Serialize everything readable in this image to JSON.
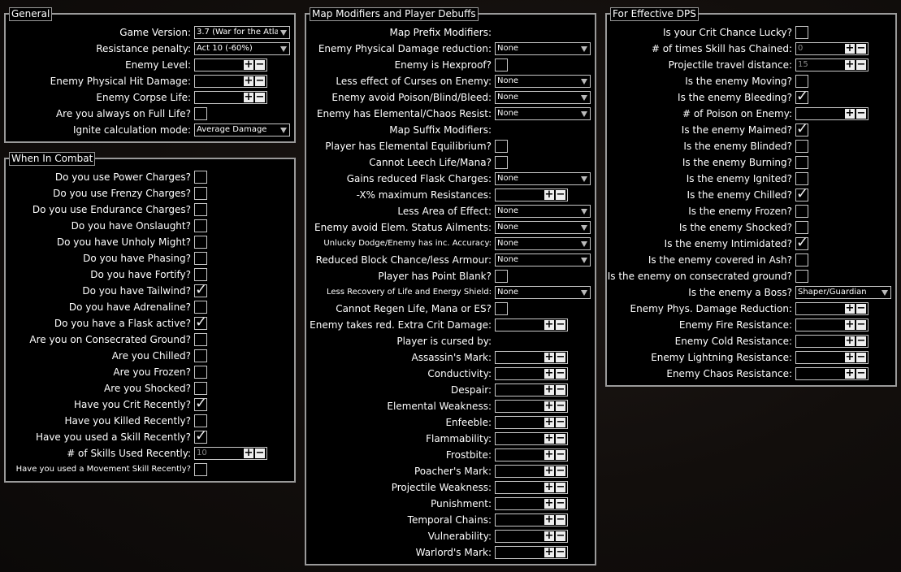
{
  "general": {
    "title": "General",
    "rows": [
      {
        "label": "Game Version:",
        "type": "dropdown",
        "value": "3.7 (War for the Atlas"
      },
      {
        "label": "Resistance penalty:",
        "type": "dropdown",
        "value": "Act 10 (-60%)"
      },
      {
        "label": "Enemy Level:",
        "type": "number",
        "value": ""
      },
      {
        "label": "Enemy Physical Hit Damage:",
        "type": "number",
        "value": ""
      },
      {
        "label": "Enemy Corpse Life:",
        "type": "number",
        "value": ""
      },
      {
        "label": "Are you always on Full Life?",
        "type": "checkbox",
        "checked": false
      },
      {
        "label": "Ignite calculation mode:",
        "type": "dropdown",
        "value": "Average Damage"
      }
    ]
  },
  "combat": {
    "title": "When In Combat",
    "rows": [
      {
        "label": "Do you use Power Charges?",
        "type": "checkbox",
        "checked": false
      },
      {
        "label": "Do you use Frenzy Charges?",
        "type": "checkbox",
        "checked": false
      },
      {
        "label": "Do you use Endurance Charges?",
        "type": "checkbox",
        "checked": false
      },
      {
        "label": "Do you have Onslaught?",
        "type": "checkbox",
        "checked": false
      },
      {
        "label": "Do you have Unholy Might?",
        "type": "checkbox",
        "checked": false
      },
      {
        "label": "Do you have Phasing?",
        "type": "checkbox",
        "checked": false
      },
      {
        "label": "Do you have Fortify?",
        "type": "checkbox",
        "checked": false
      },
      {
        "label": "Do you have Tailwind?",
        "type": "checkbox",
        "checked": true
      },
      {
        "label": "Do you have Adrenaline?",
        "type": "checkbox",
        "checked": false
      },
      {
        "label": "Do you have a Flask active?",
        "type": "checkbox",
        "checked": true
      },
      {
        "label": "Are you on Consecrated Ground?",
        "type": "checkbox",
        "checked": false
      },
      {
        "label": "Are you Chilled?",
        "type": "checkbox",
        "checked": false
      },
      {
        "label": "Are you Frozen?",
        "type": "checkbox",
        "checked": false
      },
      {
        "label": "Are you Shocked?",
        "type": "checkbox",
        "checked": false
      },
      {
        "label": "Have you Crit Recently?",
        "type": "checkbox",
        "checked": true
      },
      {
        "label": "Have you Killed Recently?",
        "type": "checkbox",
        "checked": false
      },
      {
        "label": "Have you used a Skill Recently?",
        "type": "checkbox",
        "checked": true
      },
      {
        "label": "# of Skills Used Recently:",
        "type": "number",
        "value": "10"
      },
      {
        "label": "Have you used a Movement Skill Recently?",
        "type": "checkbox",
        "checked": false,
        "small": true
      }
    ]
  },
  "map": {
    "title": "Map Modifiers and Player Debuffs",
    "rows": [
      {
        "label": "Map Prefix Modifiers:",
        "type": "none"
      },
      {
        "label": "Enemy Physical Damage reduction:",
        "type": "dropdown",
        "value": "None"
      },
      {
        "label": "Enemy is Hexproof?",
        "type": "checkbox",
        "checked": false
      },
      {
        "label": "Less effect of Curses on Enemy:",
        "type": "dropdown",
        "value": "None"
      },
      {
        "label": "Enemy avoid Poison/Blind/Bleed:",
        "type": "dropdown",
        "value": "None"
      },
      {
        "label": "Enemy has Elemental/Chaos Resist:",
        "type": "dropdown",
        "value": "None"
      },
      {
        "label": "Map Suffix Modifiers:",
        "type": "none"
      },
      {
        "label": "Player has Elemental Equilibrium?",
        "type": "checkbox",
        "checked": false
      },
      {
        "label": "Cannot Leech Life/Mana?",
        "type": "checkbox",
        "checked": false
      },
      {
        "label": "Gains reduced Flask Charges:",
        "type": "dropdown",
        "value": "None"
      },
      {
        "label": "-X% maximum Resistances:",
        "type": "number",
        "value": ""
      },
      {
        "label": "Less Area of Effect:",
        "type": "dropdown",
        "value": "None"
      },
      {
        "label": "Enemy avoid Elem. Status Ailments:",
        "type": "dropdown",
        "value": "None"
      },
      {
        "label": "Unlucky Dodge/Enemy has inc. Accuracy:",
        "type": "dropdown",
        "value": "None",
        "small": true
      },
      {
        "label": "Reduced Block Chance/less Armour:",
        "type": "dropdown",
        "value": "None"
      },
      {
        "label": "Player has Point Blank?",
        "type": "checkbox",
        "checked": false
      },
      {
        "label": "Less Recovery of Life and Energy Shield:",
        "type": "dropdown",
        "value": "None",
        "small": true
      },
      {
        "label": "Cannot Regen Life, Mana or ES?",
        "type": "checkbox",
        "checked": false
      },
      {
        "label": "Enemy takes red. Extra Crit Damage:",
        "type": "number",
        "value": ""
      },
      {
        "label": "Player is cursed by:",
        "type": "none"
      },
      {
        "label": "Assassin's Mark:",
        "type": "number",
        "value": ""
      },
      {
        "label": "Conductivity:",
        "type": "number",
        "value": ""
      },
      {
        "label": "Despair:",
        "type": "number",
        "value": ""
      },
      {
        "label": "Elemental Weakness:",
        "type": "number",
        "value": ""
      },
      {
        "label": "Enfeeble:",
        "type": "number",
        "value": ""
      },
      {
        "label": "Flammability:",
        "type": "number",
        "value": ""
      },
      {
        "label": "Frostbite:",
        "type": "number",
        "value": ""
      },
      {
        "label": "Poacher's Mark:",
        "type": "number",
        "value": ""
      },
      {
        "label": "Projectile Weakness:",
        "type": "number",
        "value": ""
      },
      {
        "label": "Punishment:",
        "type": "number",
        "value": ""
      },
      {
        "label": "Temporal Chains:",
        "type": "number",
        "value": ""
      },
      {
        "label": "Vulnerability:",
        "type": "number",
        "value": ""
      },
      {
        "label": "Warlord's Mark:",
        "type": "number",
        "value": ""
      }
    ]
  },
  "dps": {
    "title": "For Effective DPS",
    "rows": [
      {
        "label": "Is your Crit Chance Lucky?",
        "type": "checkbox",
        "checked": false
      },
      {
        "label": "# of times Skill has Chained:",
        "type": "number",
        "value": "0"
      },
      {
        "label": "Projectile travel distance:",
        "type": "number",
        "value": "15"
      },
      {
        "label": "Is the enemy Moving?",
        "type": "checkbox",
        "checked": false
      },
      {
        "label": "Is the enemy Bleeding?",
        "type": "checkbox",
        "checked": true
      },
      {
        "label": "# of Poison on Enemy:",
        "type": "number",
        "value": ""
      },
      {
        "label": "Is the enemy Maimed?",
        "type": "checkbox",
        "checked": true
      },
      {
        "label": "Is the enemy Blinded?",
        "type": "checkbox",
        "checked": false
      },
      {
        "label": "Is the enemy Burning?",
        "type": "checkbox",
        "checked": false
      },
      {
        "label": "Is the enemy Ignited?",
        "type": "checkbox",
        "checked": false
      },
      {
        "label": "Is the enemy Chilled?",
        "type": "checkbox",
        "checked": true
      },
      {
        "label": "Is the enemy Frozen?",
        "type": "checkbox",
        "checked": false
      },
      {
        "label": "Is the enemy Shocked?",
        "type": "checkbox",
        "checked": false
      },
      {
        "label": "Is the enemy Intimidated?",
        "type": "checkbox",
        "checked": true
      },
      {
        "label": "Is the enemy covered in Ash?",
        "type": "checkbox",
        "checked": false
      },
      {
        "label": "Is the enemy on consecrated ground?",
        "type": "checkbox",
        "checked": false
      },
      {
        "label": "Is the enemy a Boss?",
        "type": "dropdown",
        "value": "Shaper/Guardian"
      },
      {
        "label": "Enemy Phys. Damage Reduction:",
        "type": "number",
        "value": ""
      },
      {
        "label": "Enemy Fire Resistance:",
        "type": "number",
        "value": ""
      },
      {
        "label": "Enemy Cold Resistance:",
        "type": "number",
        "value": ""
      },
      {
        "label": "Enemy Lightning Resistance:",
        "type": "number",
        "value": ""
      },
      {
        "label": "Enemy Chaos Resistance:",
        "type": "number",
        "value": ""
      }
    ]
  },
  "icons": {
    "checkmark": "✓",
    "plus": "+",
    "minus": "−"
  }
}
